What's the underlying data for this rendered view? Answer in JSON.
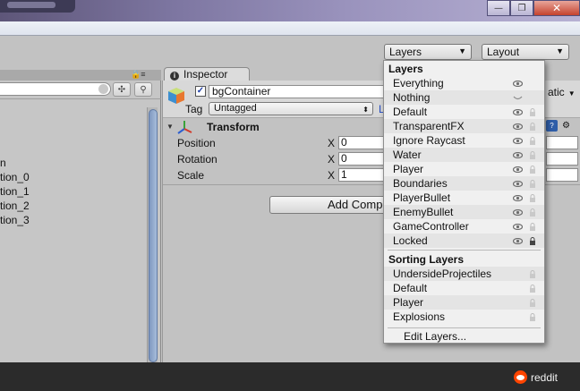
{
  "window": {
    "minimize_glyph": "—",
    "maximize_glyph": "❐",
    "close_glyph": "✕"
  },
  "toolbar": {
    "layers_label": "Layers",
    "layout_label": "Layout"
  },
  "hierarchy": {
    "items": [
      "n",
      "tion_0",
      "tion_1",
      "tion_2",
      "tion_3"
    ]
  },
  "inspector": {
    "tab_label": "Inspector",
    "object_name": "bgContainer",
    "static_label": "atic",
    "tag_label": "Tag",
    "tag_value": "Untagged",
    "layer_label": "L",
    "transform_title": "Transform",
    "position_label": "Position",
    "rotation_label": "Rotation",
    "scale_label": "Scale",
    "x_label": "X",
    "position_x": "0",
    "rotation_x": "0",
    "scale_x": "1",
    "add_component": "Add Component"
  },
  "layers_menu": {
    "layers_header": "Layers",
    "layers": [
      "Everything",
      "Nothing",
      "Default",
      "TransparentFX",
      "Ignore Raycast",
      "Water",
      "Player",
      "Boundaries",
      "PlayerBullet",
      "EnemyBullet",
      "GameController",
      "Locked"
    ],
    "sorting_header": "Sorting Layers",
    "sorting_layers": [
      "UndersideProjectiles",
      "Default",
      "Player",
      "Explosions"
    ],
    "edit_layers": "Edit Layers..."
  },
  "footer": {
    "reddit_label": "reddit"
  },
  "colors": {
    "accent_blue": "#2149c2",
    "reddit_orange": "#ff4500"
  }
}
